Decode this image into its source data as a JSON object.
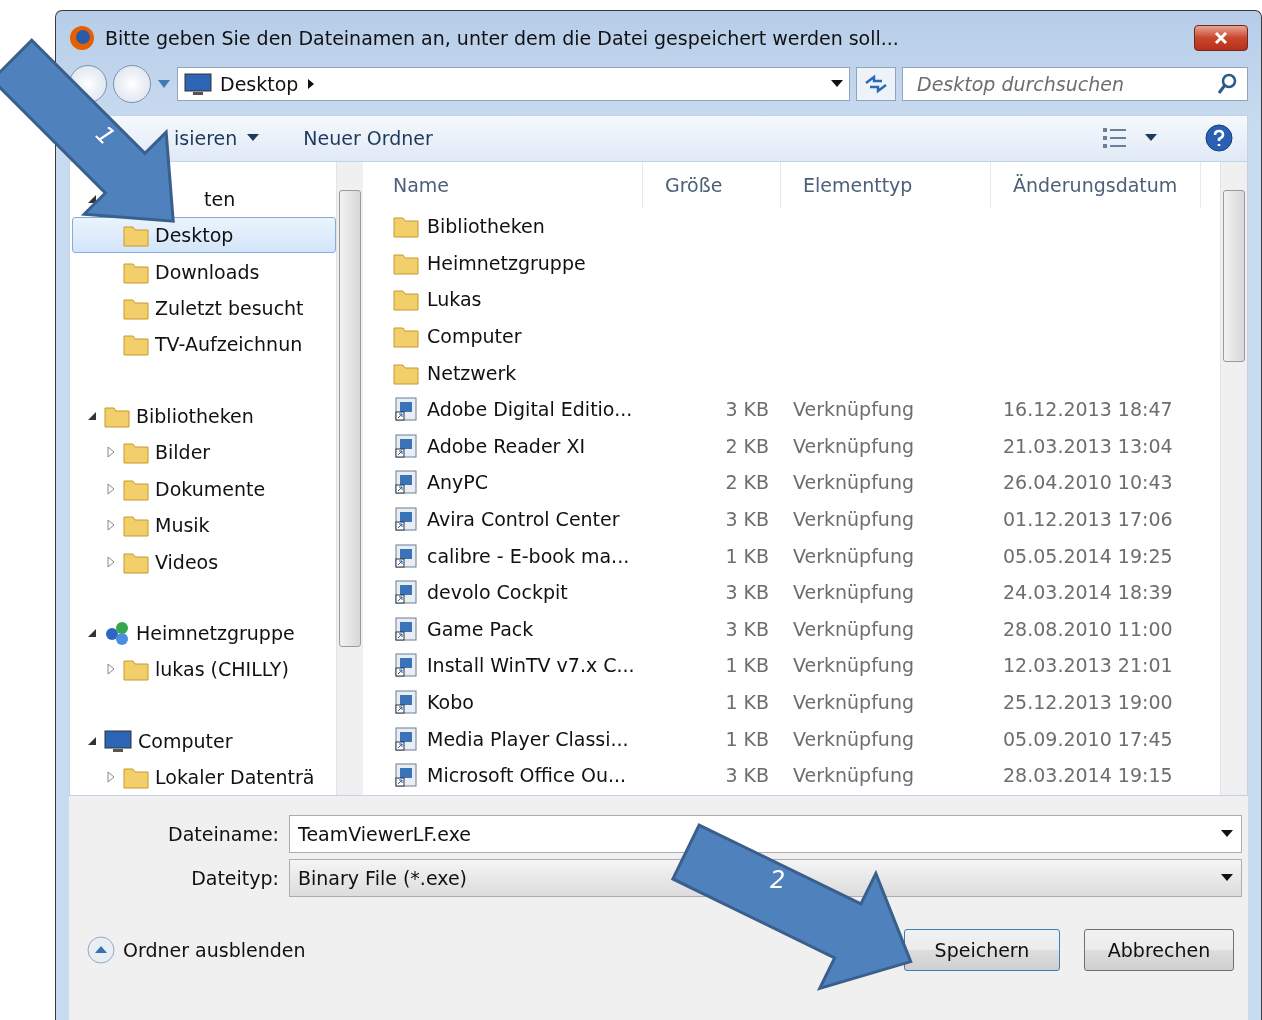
{
  "window": {
    "title": "Bitte geben Sie den Dateinamen an, unter dem die Datei gespeichert werden soll..."
  },
  "address": {
    "location": "Desktop",
    "search_placeholder": "Desktop durchsuchen"
  },
  "toolbar": {
    "organize": "isieren",
    "new_folder": "Neuer Ordner"
  },
  "sidebar": {
    "groups": [
      {
        "label": "ten",
        "expanded": true,
        "children": [
          {
            "label": "Desktop",
            "selected": true
          },
          {
            "label": "Downloads",
            "selected": false
          },
          {
            "label": "Zuletzt besucht",
            "selected": false
          },
          {
            "label": "TV-Aufzeichnun",
            "selected": false
          }
        ]
      },
      {
        "label": "Bibliotheken",
        "expanded": true,
        "children": [
          {
            "label": "Bilder",
            "selected": false,
            "expanded": false
          },
          {
            "label": "Dokumente",
            "selected": false,
            "expanded": false
          },
          {
            "label": "Musik",
            "selected": false,
            "expanded": false
          },
          {
            "label": "Videos",
            "selected": false,
            "expanded": false
          }
        ]
      },
      {
        "label": "Heimnetzgruppe",
        "expanded": true,
        "children": [
          {
            "label": "lukas (CHILLY)",
            "selected": false,
            "expanded": false
          }
        ]
      },
      {
        "label": "Computer",
        "expanded": true,
        "children": [
          {
            "label": "Lokaler Datenträ",
            "selected": false,
            "expanded": false
          }
        ]
      }
    ]
  },
  "table": {
    "columns": [
      "Name",
      "Größe",
      "Elementtyp",
      "Änderungsdatum"
    ],
    "rows": [
      {
        "name": "Bibliotheken",
        "kind": "folder"
      },
      {
        "name": "Heimnetzgruppe",
        "kind": "folder"
      },
      {
        "name": "Lukas",
        "kind": "folder"
      },
      {
        "name": "Computer",
        "kind": "folder"
      },
      {
        "name": "Netzwerk",
        "kind": "folder"
      },
      {
        "name": "Adobe Digital Editio...",
        "size": "3 KB",
        "type": "Verknüpfung",
        "date": "16.12.2013 18:47",
        "kind": "shortcut"
      },
      {
        "name": "Adobe Reader XI",
        "size": "2 KB",
        "type": "Verknüpfung",
        "date": "21.03.2013 13:04",
        "kind": "shortcut"
      },
      {
        "name": "AnyPC",
        "size": "2 KB",
        "type": "Verknüpfung",
        "date": "26.04.2010 10:43",
        "kind": "shortcut"
      },
      {
        "name": "Avira Control Center",
        "size": "3 KB",
        "type": "Verknüpfung",
        "date": "01.12.2013 17:06",
        "kind": "shortcut"
      },
      {
        "name": "calibre - E-book ma...",
        "size": "1 KB",
        "type": "Verknüpfung",
        "date": "05.05.2014 19:25",
        "kind": "shortcut"
      },
      {
        "name": "devolo Cockpit",
        "size": "3 KB",
        "type": "Verknüpfung",
        "date": "24.03.2014 18:39",
        "kind": "shortcut"
      },
      {
        "name": "Game Pack",
        "size": "3 KB",
        "type": "Verknüpfung",
        "date": "28.08.2010 11:00",
        "kind": "shortcut"
      },
      {
        "name": "Install WinTV v7.x C...",
        "size": "1 KB",
        "type": "Verknüpfung",
        "date": "12.03.2013 21:01",
        "kind": "shortcut"
      },
      {
        "name": "Kobo",
        "size": "1 KB",
        "type": "Verknüpfung",
        "date": "25.12.2013 19:00",
        "kind": "shortcut"
      },
      {
        "name": "Media Player Classi...",
        "size": "1 KB",
        "type": "Verknüpfung",
        "date": "05.09.2010 17:45",
        "kind": "shortcut"
      },
      {
        "name": "Microsoft Office Ou...",
        "size": "3 KB",
        "type": "Verknüpfung",
        "date": "28.03.2014 19:15",
        "kind": "shortcut"
      }
    ]
  },
  "form": {
    "filename_label": "Dateiname:",
    "filename": "TeamViewerLF.exe",
    "filetype_label": "Dateityp:",
    "filetype": "Binary File (*.exe)"
  },
  "footer": {
    "hide_folders": "Ordner ausblenden",
    "save": "Speichern",
    "cancel": "Abbrechen"
  },
  "annotations": [
    {
      "label": "1"
    },
    {
      "label": "2"
    }
  ]
}
